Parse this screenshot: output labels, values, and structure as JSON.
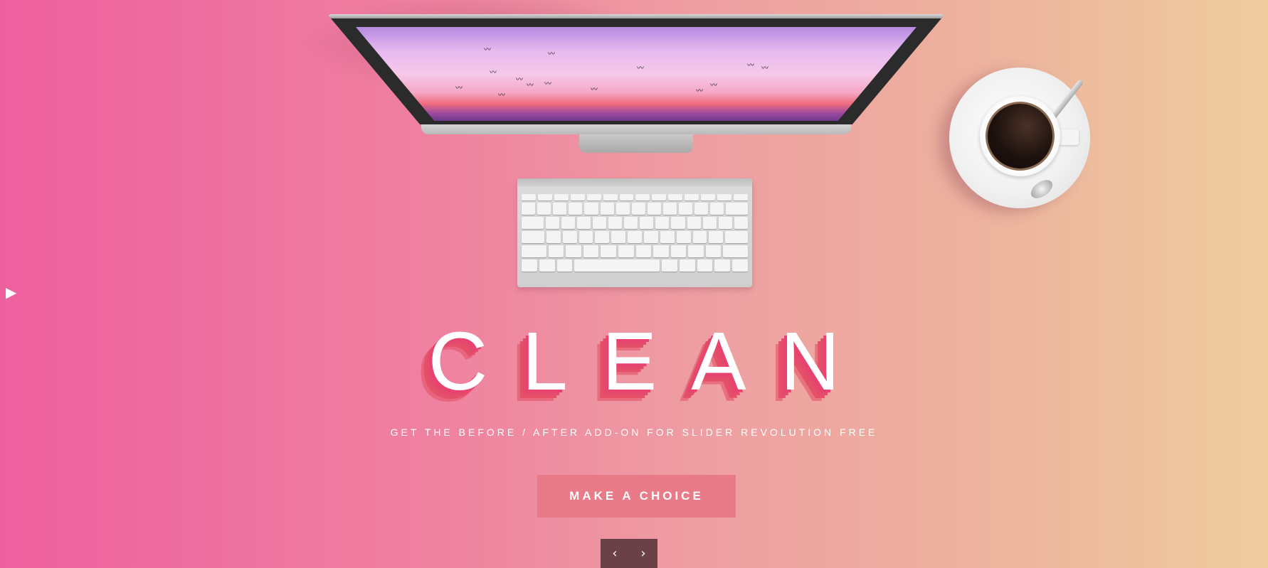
{
  "hero": {
    "headline": "CLEAN",
    "subtitle": "GET THE BEFORE / AFTER ADD-ON FOR SLIDER REVOLUTION FREE",
    "cta_label": "MAKE A CHOICE"
  },
  "icons": {
    "side_arrow": "play-icon",
    "prev": "chevron-left-icon",
    "next": "chevron-right-icon",
    "apple": "apple-icon"
  },
  "nav": {
    "prev_glyph": "‹",
    "next_glyph": "›"
  },
  "glyphs": {
    "side_arrow": "▶",
    "apple": ""
  },
  "colors": {
    "gradient_start": "#ee5f9e",
    "gradient_end": "#eecc9e",
    "cta_bg": "#e97b88",
    "nav_bg": "#6b4148",
    "text_shadow": "#e8436e"
  }
}
